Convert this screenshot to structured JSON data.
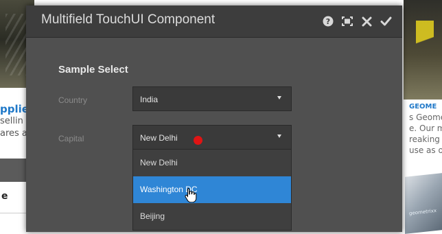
{
  "background": {
    "left_title": "pplied",
    "left_lines": [
      "sellin",
      "ares a"
    ],
    "left_tab": "e",
    "right_title": "GEOME",
    "right_lines": [
      "s Geome",
      "e. Our m",
      "reaking a",
      "use as o"
    ],
    "right_device_text": "geometrixx"
  },
  "dialog": {
    "title": "Multifield TouchUI Component",
    "header_icons": [
      "help-icon",
      "fullscreen-icon",
      "close-icon",
      "done-icon"
    ]
  },
  "form": {
    "section_title": "Sample Select",
    "country": {
      "label": "Country",
      "value": "India"
    },
    "capital": {
      "label": "Capital",
      "value": "New Delhi",
      "options": [
        "New Delhi",
        "Washington DC",
        "Beijing"
      ],
      "highlighted": "Washington DC"
    }
  },
  "colors": {
    "dialog_bg": "#505050",
    "header_bg": "#3d3d3d",
    "highlight": "#2f86d6",
    "marker": "#e01414"
  }
}
